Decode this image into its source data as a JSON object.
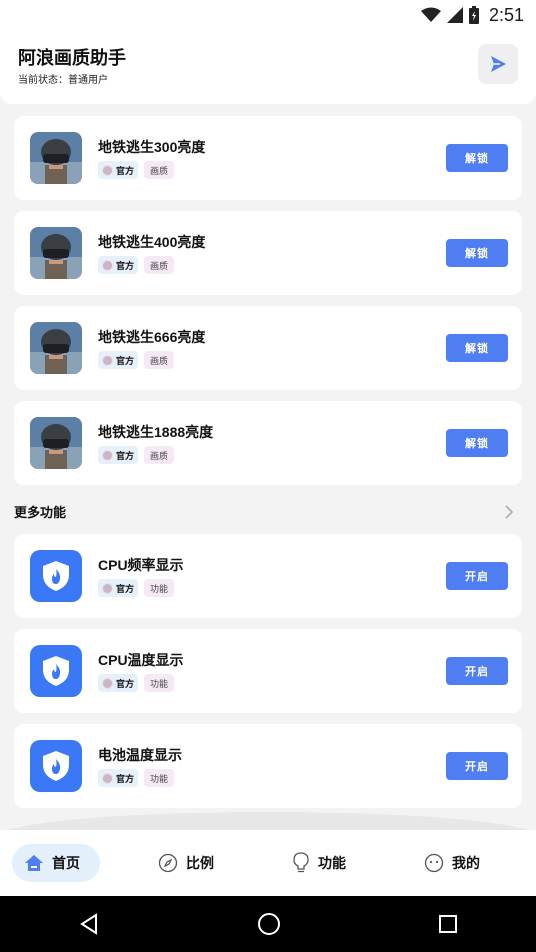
{
  "status_bar": {
    "time": "2:51"
  },
  "header": {
    "title": "阿浪画质助手",
    "status": "当前状态：普通用户"
  },
  "quality_items": [
    {
      "name": "地铁逃生300亮度",
      "official": "官方",
      "category": "画质",
      "button": "解锁"
    },
    {
      "name": "地铁逃生400亮度",
      "official": "官方",
      "category": "画质",
      "button": "解锁"
    },
    {
      "name": "地铁逃生666亮度",
      "official": "官方",
      "category": "画质",
      "button": "解锁"
    },
    {
      "name": "地铁逃生1888亮度",
      "official": "官方",
      "category": "画质",
      "button": "解锁"
    }
  ],
  "more_section": {
    "title": "更多功能"
  },
  "feature_items": [
    {
      "name": "CPU频率显示",
      "official": "官方",
      "category": "功能",
      "button": "开启"
    },
    {
      "name": "CPU温度显示",
      "official": "官方",
      "category": "功能",
      "button": "开启"
    },
    {
      "name": "电池温度显示",
      "official": "官方",
      "category": "功能",
      "button": "开启"
    }
  ],
  "bottom_nav": {
    "items": [
      {
        "label": "首页",
        "icon": "home-icon",
        "active": true
      },
      {
        "label": "比例",
        "icon": "compass-icon",
        "active": false
      },
      {
        "label": "功能",
        "icon": "lightbulb-icon",
        "active": false
      },
      {
        "label": "我的",
        "icon": "face-icon",
        "active": false
      }
    ]
  },
  "colors": {
    "accent": "#4f7df2",
    "shield": "#3a78f5",
    "active_nav_bg": "#e4effc"
  }
}
